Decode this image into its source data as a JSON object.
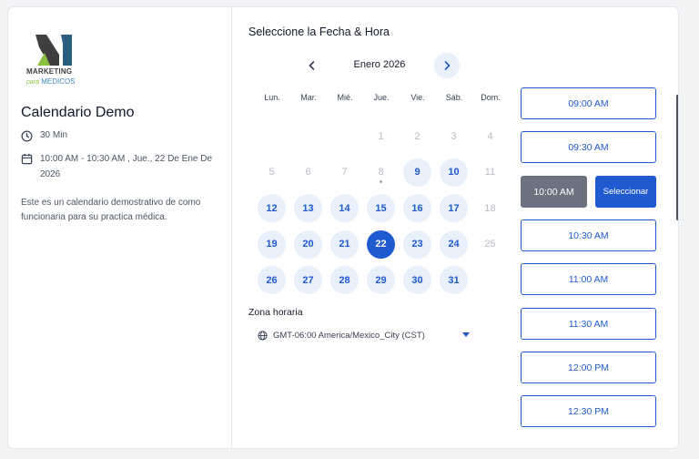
{
  "logo": {
    "word_main": "MARKETING",
    "word_accent": "",
    "sub_para": "para",
    "sub_main": "MEDICOS"
  },
  "event": {
    "title": "Calendario Demo",
    "duration": "30 Min",
    "datetime": "10:00 AM - 10:30 AM , Jue., 22 De Ene De 2026",
    "description": "Este es un calendario demostrativo de como funcionaria para su practica médica."
  },
  "picker": {
    "heading": "Seleccione la Fecha & Hora",
    "month_label": "Enero 2026",
    "weekdays": [
      "Lun.",
      "Mar.",
      "Mié.",
      "Jue.",
      "Vie.",
      "Sáb.",
      "Dom."
    ],
    "days": [
      {
        "label": "1",
        "state": "disabled",
        "col": 3,
        "row": 0
      },
      {
        "label": "2",
        "state": "disabled",
        "col": 4,
        "row": 0
      },
      {
        "label": "3",
        "state": "disabled",
        "col": 5,
        "row": 0
      },
      {
        "label": "4",
        "state": "disabled",
        "col": 6,
        "row": 0
      },
      {
        "label": "5",
        "state": "disabled",
        "col": 0,
        "row": 1
      },
      {
        "label": "6",
        "state": "disabled",
        "col": 1,
        "row": 1
      },
      {
        "label": "7",
        "state": "disabled",
        "col": 2,
        "row": 1
      },
      {
        "label": "8",
        "state": "disabled",
        "col": 3,
        "row": 1,
        "today": true
      },
      {
        "label": "9",
        "state": "available",
        "col": 4,
        "row": 1
      },
      {
        "label": "10",
        "state": "available",
        "col": 5,
        "row": 1
      },
      {
        "label": "11",
        "state": "disabled",
        "col": 6,
        "row": 1
      },
      {
        "label": "12",
        "state": "available",
        "col": 0,
        "row": 2
      },
      {
        "label": "13",
        "state": "available",
        "col": 1,
        "row": 2
      },
      {
        "label": "14",
        "state": "available",
        "col": 2,
        "row": 2
      },
      {
        "label": "15",
        "state": "available",
        "col": 3,
        "row": 2
      },
      {
        "label": "16",
        "state": "available",
        "col": 4,
        "row": 2
      },
      {
        "label": "17",
        "state": "available",
        "col": 5,
        "row": 2
      },
      {
        "label": "18",
        "state": "disabled",
        "col": 6,
        "row": 2
      },
      {
        "label": "19",
        "state": "available",
        "col": 0,
        "row": 3
      },
      {
        "label": "20",
        "state": "available",
        "col": 1,
        "row": 3
      },
      {
        "label": "21",
        "state": "available",
        "col": 2,
        "row": 3
      },
      {
        "label": "22",
        "state": "selected",
        "col": 3,
        "row": 3
      },
      {
        "label": "23",
        "state": "available",
        "col": 4,
        "row": 3
      },
      {
        "label": "24",
        "state": "available",
        "col": 5,
        "row": 3
      },
      {
        "label": "25",
        "state": "disabled",
        "col": 6,
        "row": 3
      },
      {
        "label": "26",
        "state": "available",
        "col": 0,
        "row": 4
      },
      {
        "label": "27",
        "state": "available",
        "col": 1,
        "row": 4
      },
      {
        "label": "28",
        "state": "available",
        "col": 2,
        "row": 4
      },
      {
        "label": "29",
        "state": "available",
        "col": 3,
        "row": 4
      },
      {
        "label": "30",
        "state": "available",
        "col": 4,
        "row": 4
      },
      {
        "label": "31",
        "state": "available",
        "col": 5,
        "row": 4
      }
    ],
    "timezone_label": "Zona horaria",
    "timezone_value": "GMT-06:00 America/Mexico_City (CST)"
  },
  "slots": {
    "times": [
      "09:00 AM",
      "09:30 AM",
      "10:00 AM",
      "10:30 AM",
      "11:00 AM",
      "11:30 AM",
      "12:00 PM",
      "12:30 PM"
    ],
    "selected_index": 2,
    "confirm_label": "Seleccionar"
  },
  "icons": {
    "prev": "chevron-left-icon",
    "next": "chevron-right-icon",
    "duration": "clock-icon",
    "datetime": "calendar-icon",
    "timezone": "globe-icon",
    "timezone_dropdown": "caret-down-icon"
  },
  "colors": {
    "accent": "#1f5ad1",
    "available_bg": "#e8f0fb",
    "chosen_slot": "#6b7280",
    "logo_green": "#8bbf3f",
    "logo_blue": "#3c8dbc"
  }
}
